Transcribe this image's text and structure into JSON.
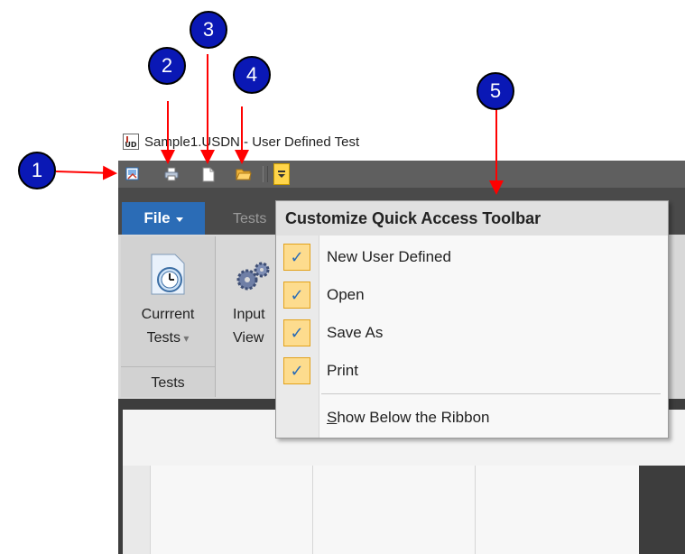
{
  "window": {
    "icon_text": "UD",
    "title": "Sample1.USDN - User Defined Test"
  },
  "quick_access_toolbar": {
    "buttons": [
      {
        "icon": "new-user-defined-icon"
      },
      {
        "icon": "print-icon"
      },
      {
        "icon": "save-as-icon"
      },
      {
        "icon": "open-folder-icon"
      }
    ],
    "customize_icon": "customize-dropdown-icon"
  },
  "ribbon": {
    "tabs": {
      "file": "File",
      "tests": "Tests"
    },
    "groups": [
      {
        "label": "Tests",
        "button_line1": "Currrent",
        "button_line2": "Tests",
        "button_icon": "current-tests-icon"
      },
      {
        "button_line1": "Input",
        "button_line2": "View",
        "button_icon": "gears-icon"
      }
    ]
  },
  "customize_menu": {
    "title": "Customize Quick Access Toolbar",
    "items": [
      {
        "label": "New User Defined",
        "checked": true
      },
      {
        "label": "Open",
        "checked": true
      },
      {
        "label": "Save As",
        "checked": true
      },
      {
        "label": "Print",
        "checked": true
      }
    ],
    "show_below": {
      "prefix": "S",
      "rest": "how Below the Ribbon"
    },
    "check_glyph": "✓"
  },
  "callouts": [
    "1",
    "2",
    "3",
    "4",
    "5"
  ],
  "colors": {
    "callout_fill": "#0a18b5",
    "arrow": "#ff0000",
    "file_tab": "#2b6cb6",
    "checkbox_fill": "#fddc8e"
  }
}
